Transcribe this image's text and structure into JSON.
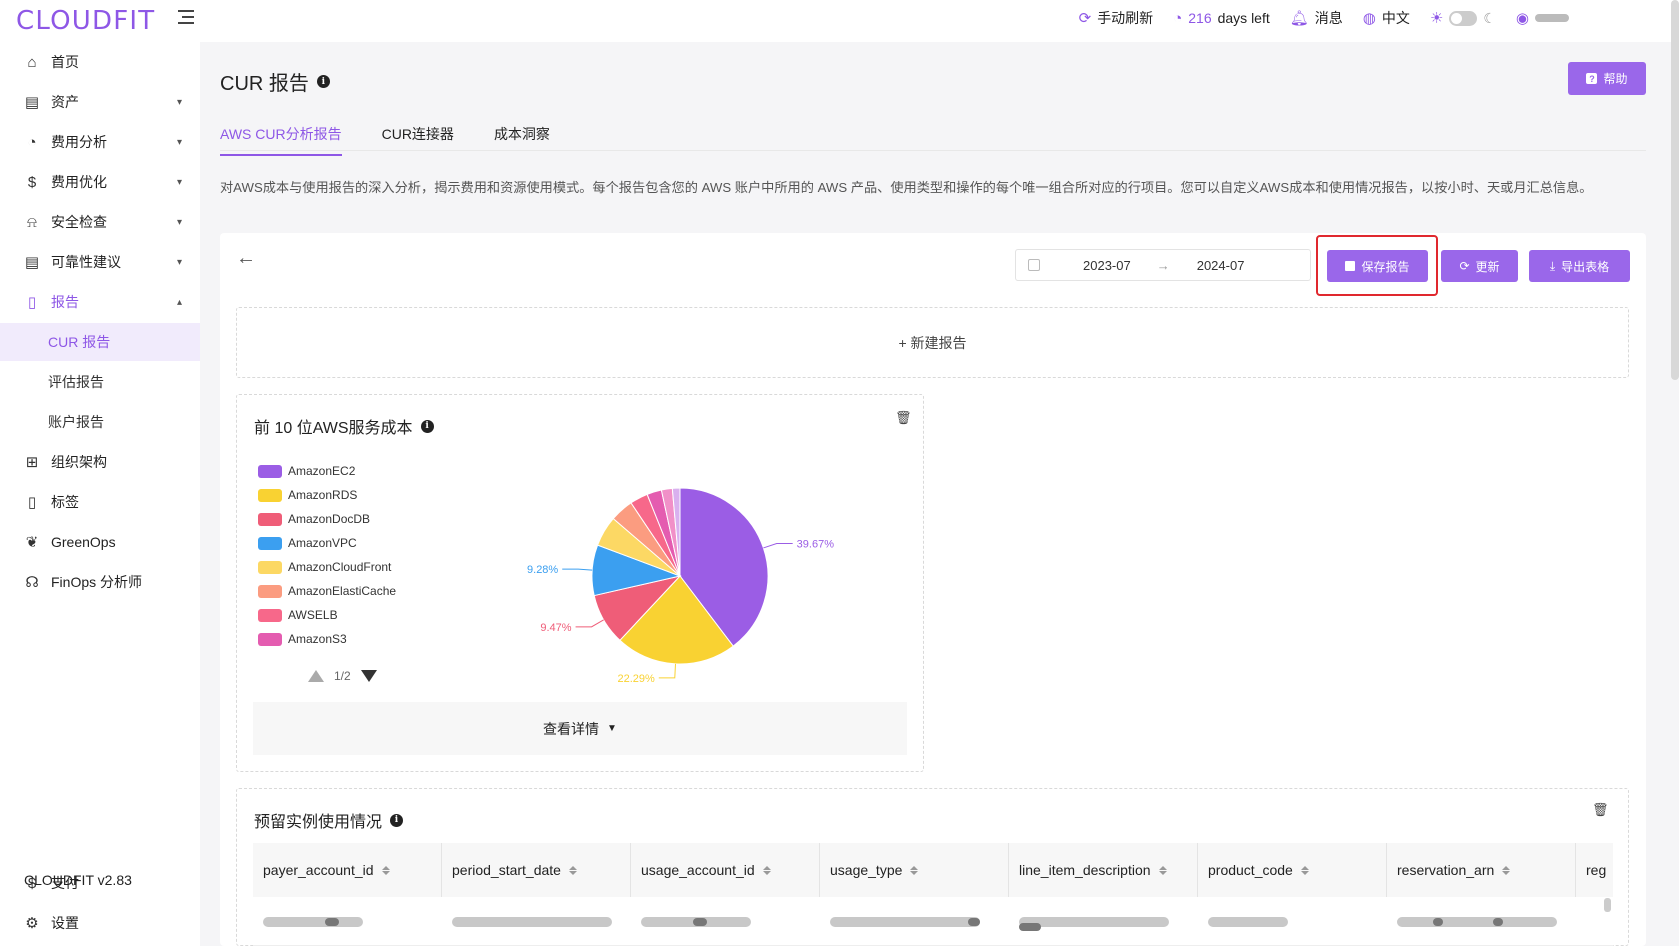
{
  "app": {
    "logo": "CLOUDFIT",
    "version": "CLOUDFIT v2.83"
  },
  "topbar": {
    "refresh_label": "手动刷新",
    "days_num": "216",
    "days_text": "days left",
    "messages_label": "消息",
    "language_label": "中文"
  },
  "sidebar": {
    "items": [
      {
        "label": "首页"
      },
      {
        "label": "资产"
      },
      {
        "label": "费用分析"
      },
      {
        "label": "费用优化"
      },
      {
        "label": "安全检查"
      },
      {
        "label": "可靠性建议"
      },
      {
        "label": "报告"
      },
      {
        "label": "组织架构"
      },
      {
        "label": "标签"
      },
      {
        "label": "GreenOps"
      },
      {
        "label": "FinOps 分析师"
      }
    ],
    "report_sub": [
      {
        "label": "CUR 报告"
      },
      {
        "label": "评估报告"
      },
      {
        "label": "账户报告"
      }
    ],
    "bottom": [
      {
        "label": "支付"
      },
      {
        "label": "设置"
      }
    ]
  },
  "page": {
    "title": "CUR 报告",
    "help_label": "帮助",
    "tabs": [
      {
        "label": "AWS CUR分析报告"
      },
      {
        "label": "CUR连接器"
      },
      {
        "label": "成本洞察"
      }
    ],
    "description": "对AWS成本与使用报告的深入分析，揭示费用和资源使用模式。每个报告包含您的 AWS 账户中所用的 AWS 产品、使用类型和操作的每个唯一组合所对应的行项目。您可以自定义AWS成本和使用情况报告，以按小时、天或月汇总信息。"
  },
  "toolbar": {
    "date_start": "2023-07",
    "date_end": "2024-07",
    "save_label": "保存报告",
    "update_label": "更新",
    "export_label": "导出表格"
  },
  "new_report_label": "+ 新建报告",
  "pie_card": {
    "title": "前 10 位AWS服务成本",
    "pager": "1/2",
    "view_detail_label": "查看详情"
  },
  "chart_data": {
    "type": "pie",
    "title": "前 10 位AWS服务成本",
    "legend": [
      "AmazonEC2",
      "AmazonRDS",
      "AmazonDocDB",
      "AmazonVPC",
      "AmazonCloudFront",
      "AmazonElastiCache",
      "AWSELB",
      "AmazonS3"
    ],
    "legend_colors": [
      "#9b5de5",
      "#f9d232",
      "#ef5d78",
      "#3b9ff0",
      "#fcd864",
      "#fb9c80",
      "#f7688a",
      "#e45cb0"
    ],
    "slices": [
      {
        "name": "AmazonEC2",
        "value": 39.67,
        "label": "39.67%",
        "color": "#9b5de5"
      },
      {
        "name": "AmazonRDS",
        "value": 22.29,
        "label": "22.29%",
        "color": "#f9d232"
      },
      {
        "name": "AmazonDocDB",
        "value": 9.47,
        "label": "9.47%",
        "color": "#ef5d78"
      },
      {
        "name": "AmazonVPC",
        "value": 9.28,
        "label": "9.28%",
        "color": "#3b9ff0"
      },
      {
        "name": "AmazonCloudFront",
        "value": 5.6,
        "color": "#fcd864"
      },
      {
        "name": "AmazonElastiCache",
        "value": 4.3,
        "color": "#fb9c80"
      },
      {
        "name": "AWSELB",
        "value": 3.3,
        "color": "#f7688a"
      },
      {
        "name": "AmazonS3",
        "value": 2.7,
        "color": "#e45cb0"
      },
      {
        "name": "",
        "value": 2.0,
        "color": "#f190c8"
      },
      {
        "name": "",
        "value": 1.39,
        "color": "#d9b0ef"
      }
    ]
  },
  "ri_card": {
    "title": "预留实例使用情况",
    "columns": [
      "payer_account_id",
      "period_start_date",
      "usage_account_id",
      "usage_type",
      "line_item_description",
      "product_code",
      "reservation_arn",
      "reg"
    ]
  }
}
